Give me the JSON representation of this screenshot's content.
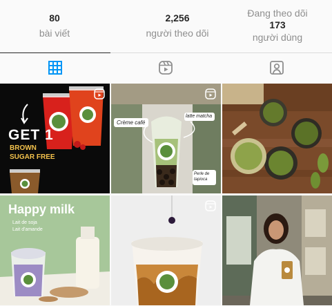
{
  "stats": {
    "posts": {
      "count": "80",
      "label": "bài viết"
    },
    "followers": {
      "count": "2,256",
      "label": "người theo dõi"
    },
    "following": {
      "label_top": "Đang theo dõi",
      "count": "173",
      "label_bottom": "người dùng"
    }
  },
  "tabs": [
    {
      "icon": "grid-icon",
      "active": true
    },
    {
      "icon": "reels-icon",
      "active": false
    },
    {
      "icon": "tagged-icon",
      "active": false
    }
  ],
  "posts": [
    {
      "type": "reel",
      "text": {
        "headline": "GET 1",
        "sub1": "BROWN",
        "sub2": "SUGAR FREE"
      }
    },
    {
      "type": "reel",
      "text": {
        "label1": "Crème café",
        "label2": "latte matcha",
        "label3": "Perle de tapioca"
      }
    },
    {
      "type": "image"
    },
    {
      "type": "image",
      "text": {
        "title": "Happy milk",
        "label1": "Lait de soja",
        "label2": "Lait d'amande"
      }
    },
    {
      "type": "reel"
    },
    {
      "type": "image"
    }
  ],
  "colors": {
    "active_tab": "#0095f6",
    "inactive_icon": "#8e8e8e",
    "text": "#262626",
    "secondary": "#8e8e8e"
  }
}
